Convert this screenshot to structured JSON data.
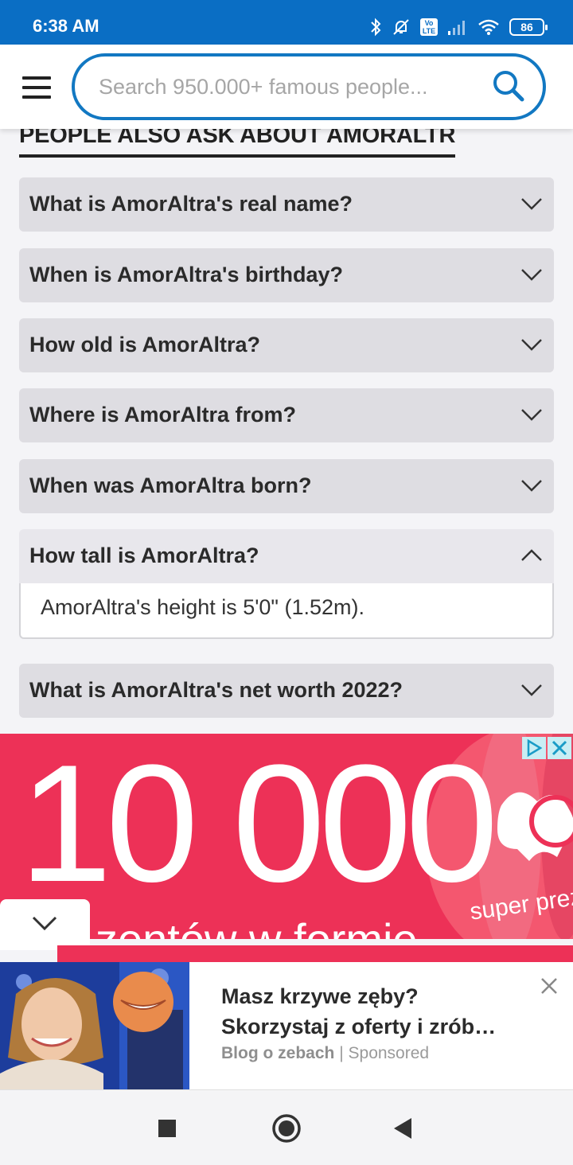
{
  "status_bar": {
    "time": "6:38 AM",
    "battery": "86",
    "volte": "Vo LTE",
    "icons": [
      "bluetooth-icon",
      "notifications-off-icon",
      "volte-icon",
      "signal-icon",
      "wifi-icon",
      "battery-icon"
    ]
  },
  "header": {
    "menu_icon": "hamburger-menu-icon",
    "search_placeholder": "Search 950.000+ famous people...",
    "search_icon": "search-icon",
    "accent_color": "#1278c2"
  },
  "section": {
    "title": "PEOPLE ALSO ASK ABOUT AMORALTRA"
  },
  "faq": {
    "items": [
      {
        "question": "What is AmorAltra's real name?",
        "expanded": false
      },
      {
        "question": "When is AmorAltra's birthday?",
        "expanded": false
      },
      {
        "question": "How old is AmorAltra?",
        "expanded": false
      },
      {
        "question": "Where is AmorAltra from?",
        "expanded": false
      },
      {
        "question": "When was AmorAltra born?",
        "expanded": false
      },
      {
        "question": "How tall is AmorAltra?",
        "expanded": true,
        "answer": "AmorAltra's height is 5'0\" (1.52m)."
      },
      {
        "question": "What is AmorAltra's net worth 2022?",
        "expanded": false
      }
    ]
  },
  "ad_banner": {
    "big_text": "10 000",
    "sub_text": "zentów w formie",
    "brand_text": "super prez",
    "background_color": "#ed3157"
  },
  "native_ad": {
    "title_line1": "Masz krzywe zęby?",
    "title_line2": "Skorzystaj z oferty i zrób…",
    "source": "Blog o zebach",
    "separator": "|",
    "sponsored": "Sponsored"
  },
  "nav_bar": {
    "icons": [
      "recents-square-icon",
      "home-circle-icon",
      "back-triangle-icon"
    ]
  }
}
